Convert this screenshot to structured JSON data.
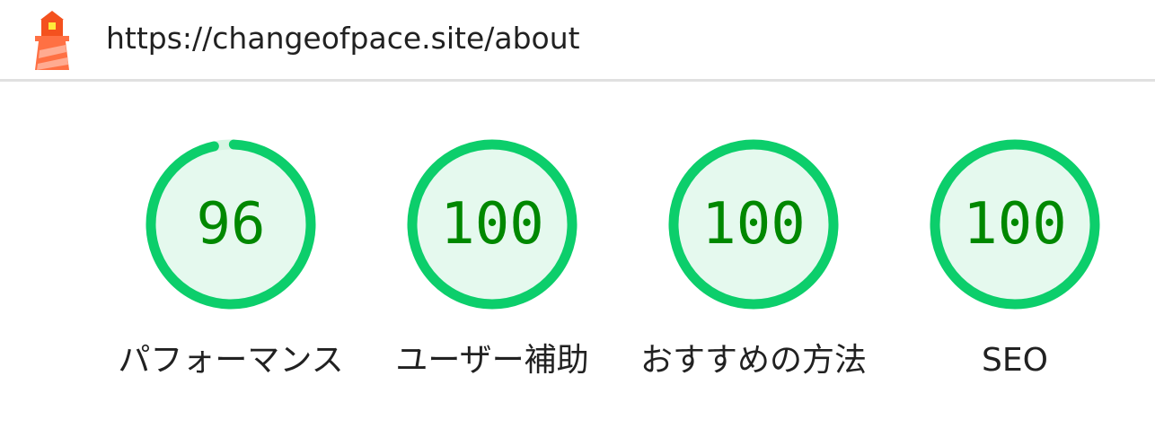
{
  "header": {
    "url": "https://changeofpace.site/about",
    "logo_icon": "lighthouse-icon"
  },
  "colors": {
    "pass_stroke": "#0cce6b",
    "pass_fill": "#e5f9ee",
    "pass_text": "#008800",
    "track": "#d6f5e3"
  },
  "gauges": [
    {
      "label": "パフォーマンス",
      "score": "96",
      "value": 96
    },
    {
      "label": "ユーザー補助",
      "score": "100",
      "value": 100
    },
    {
      "label": "おすすめの方法",
      "score": "100",
      "value": 100
    },
    {
      "label": "SEO",
      "score": "100",
      "value": 100
    }
  ]
}
